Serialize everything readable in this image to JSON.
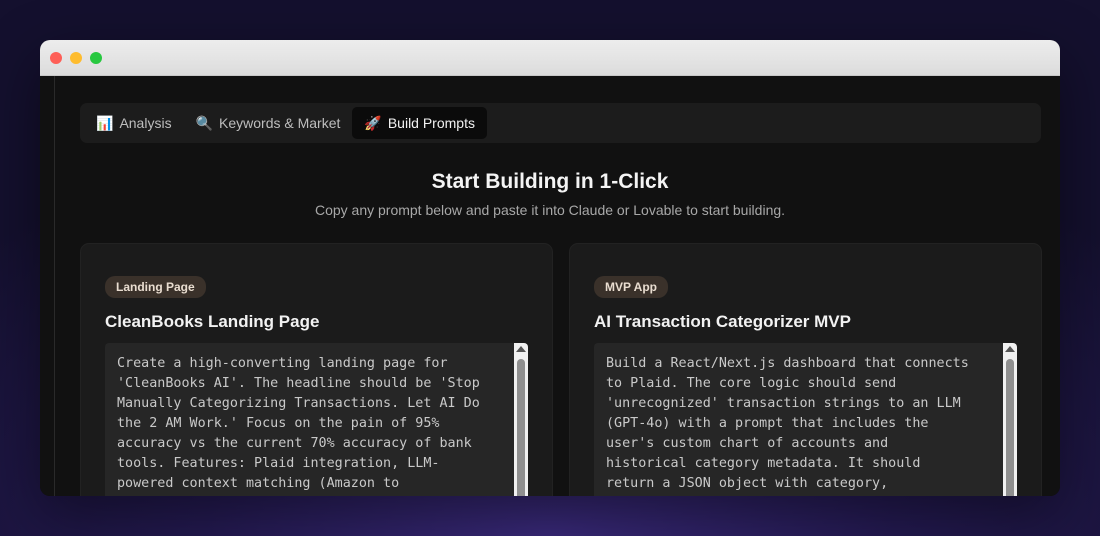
{
  "tabs": [
    {
      "icon": "📊",
      "label": "Analysis"
    },
    {
      "icon": "🔍",
      "label": "Keywords & Market"
    },
    {
      "icon": "🚀",
      "label": "Build Prompts"
    }
  ],
  "active_tab": "Build Prompts",
  "header": {
    "title": "Start Building in 1-Click",
    "subtitle": "Copy any prompt below and paste it into Claude or Lovable to start building."
  },
  "cards": [
    {
      "badge": "Landing Page",
      "title": "CleanBooks Landing Page",
      "prompt": "Create a high-converting landing page for\n'CleanBooks AI'. The headline should be 'Stop\nManually Categorizing Transactions. Let AI Do\nthe 2 AM Work.' Focus on the pain of 95%\naccuracy vs the current 70% accuracy of bank\ntools. Features: Plaid integration, LLM-\npowered context matching (Amazon to"
    },
    {
      "badge": "MVP App",
      "title": "AI Transaction Categorizer MVP",
      "prompt": "Build a React/Next.js dashboard that connects\nto Plaid. The core logic should send\n'unrecognized' transaction strings to an LLM\n(GPT-4o) with a prompt that includes the\nuser's custom chart of accounts and\nhistorical category metadata. It should\nreturn a JSON object with category,"
    }
  ],
  "colors": {
    "background_glow": "#3a2a7c",
    "app_background": "#111111",
    "card_background": "#1b1b1b",
    "badge_background": "#3a312a",
    "prompt_background": "#262626"
  }
}
